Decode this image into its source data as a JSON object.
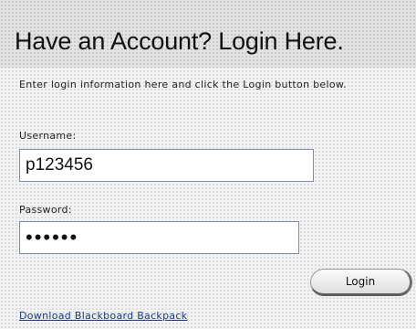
{
  "login_form": {
    "title": "Have an Account? Login Here.",
    "instructions": "Enter login information here and click the Login button below.",
    "username_label": "Username:",
    "username_value": "p123456",
    "password_label": "Password:",
    "password_value": "******",
    "login_button": "Login",
    "download_link": "Download Blackboard Backpack"
  }
}
